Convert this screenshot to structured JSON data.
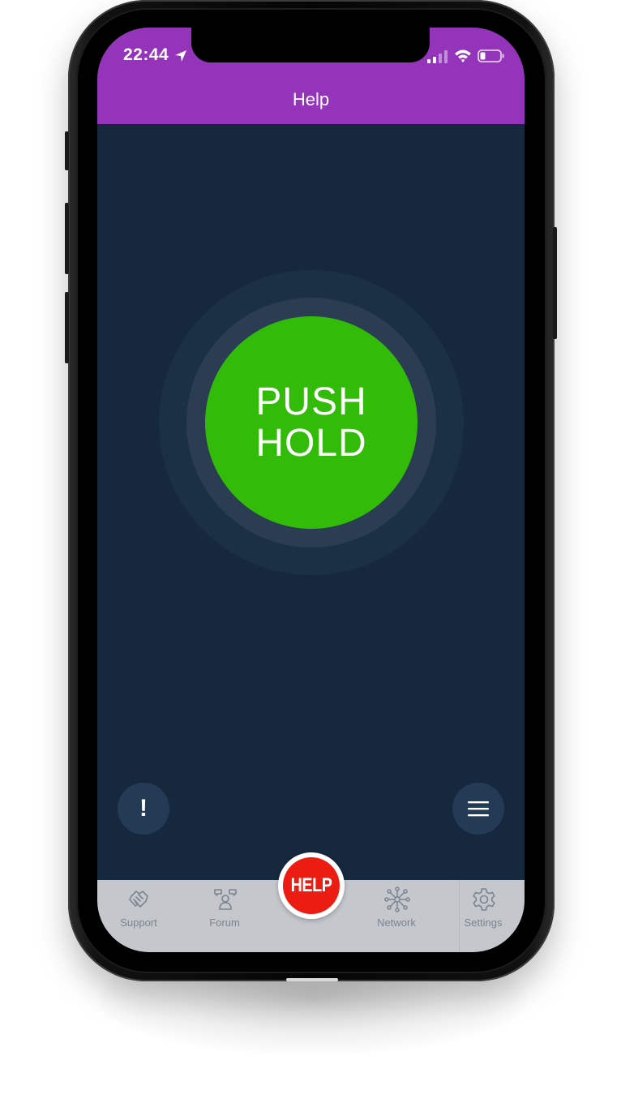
{
  "status_bar": {
    "time": "22:44",
    "icons": [
      "location-arrow-icon",
      "signal-icon",
      "wifi-icon",
      "battery-icon"
    ]
  },
  "header": {
    "title": "Help"
  },
  "main": {
    "push_button": {
      "line1": "PUSH",
      "line2": "HOLD"
    },
    "alert_button": {
      "label": "!"
    },
    "menu_button": {
      "icon": "hamburger-menu-icon"
    }
  },
  "tab_bar": {
    "tabs": [
      {
        "label": "Support",
        "icon": "handshake-icon"
      },
      {
        "label": "Forum",
        "icon": "forum-people-icon"
      },
      {
        "label": "Network",
        "icon": "network-icon"
      },
      {
        "label": "Settings",
        "icon": "gear-icon"
      }
    ],
    "help_button": {
      "label": "HELP"
    }
  },
  "colors": {
    "header": "#9434bb",
    "background": "#16283d",
    "push_button": "#33bb0a",
    "help_button": "#ec1c13",
    "tab_bar": "#c4c8cd"
  }
}
